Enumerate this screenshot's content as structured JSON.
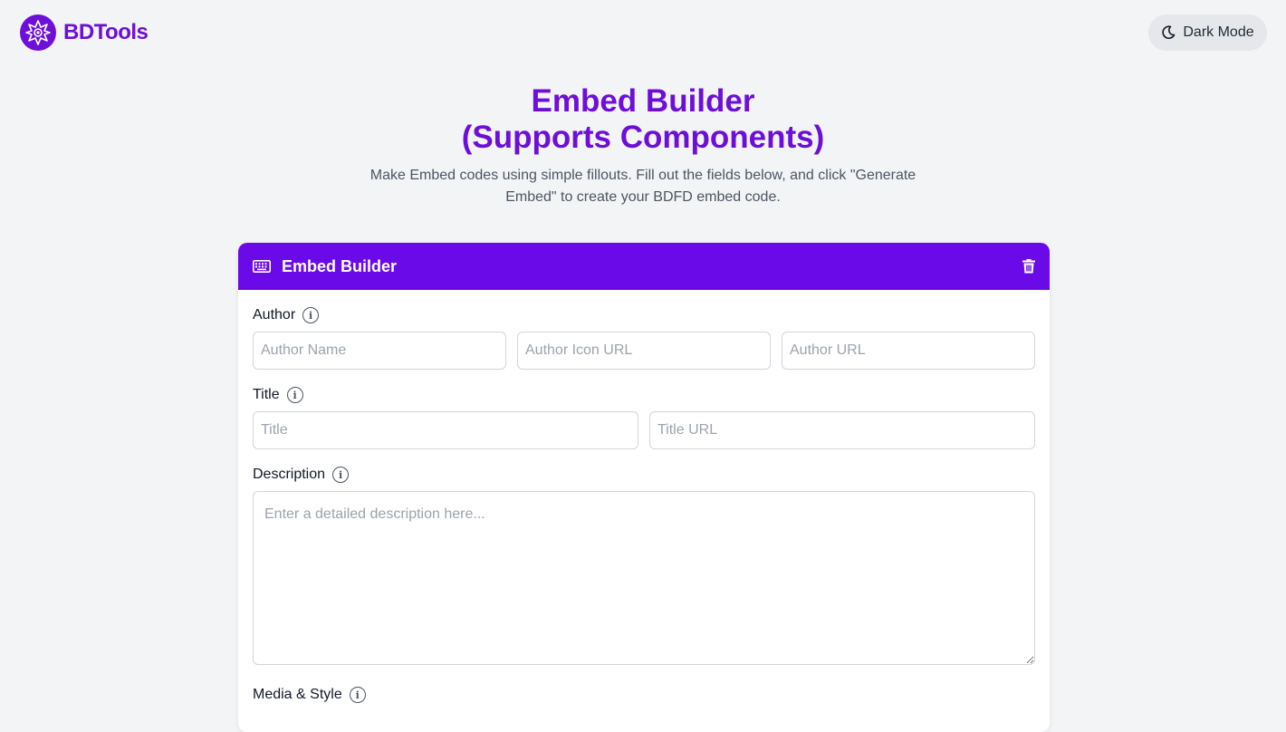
{
  "brand": {
    "name": "BDTools",
    "color": "#6d0fd8"
  },
  "topbar": {
    "dark_mode_label": "Dark Mode",
    "dark_mode_icon": "moon-icon"
  },
  "hero": {
    "title_line1": "Embed Builder",
    "title_line2": "(Supports Components)",
    "subtitle": "Make Embed codes using simple fillouts. Fill out the fields below, and click \"Generate Embed\" to create your BDFD embed code."
  },
  "card": {
    "header_title": "Embed Builder",
    "header_icon": "keyboard-icon",
    "delete_icon": "trash-icon",
    "header_color": "#6a0ae8",
    "sections": {
      "author": {
        "label": "Author",
        "name_placeholder": "Author Name",
        "icon_url_placeholder": "Author Icon URL",
        "url_placeholder": "Author URL"
      },
      "title": {
        "label": "Title",
        "title_placeholder": "Title",
        "url_placeholder": "Title URL"
      },
      "description": {
        "label": "Description",
        "placeholder": "Enter a detailed description here..."
      },
      "media": {
        "label": "Media & Style"
      }
    }
  }
}
